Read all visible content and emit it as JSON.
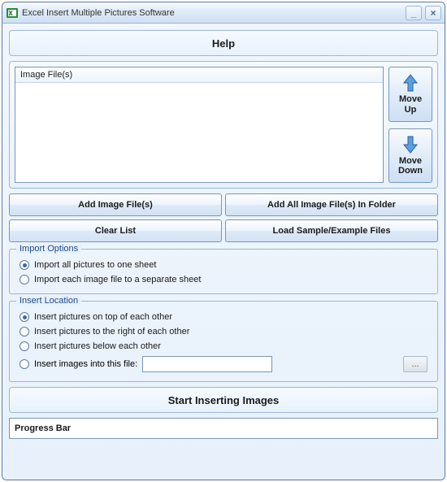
{
  "window": {
    "title": "Excel Insert Multiple Pictures Software"
  },
  "help": {
    "label": "Help"
  },
  "list": {
    "header": "Image File(s)"
  },
  "moveButtons": {
    "up": "Move\nUp",
    "down": "Move\nDown"
  },
  "buttons": {
    "addFiles": "Add Image File(s)",
    "addFolder": "Add All Image File(s) In Folder",
    "clear": "Clear List",
    "loadSample": "Load Sample/Example Files"
  },
  "importOptions": {
    "legend": "Import Options",
    "opt1": "Import all pictures to one sheet",
    "opt2": "Import each image file to a separate sheet"
  },
  "insertLocation": {
    "legend": "Insert Location",
    "opt1": "Insert pictures on top of each other",
    "opt2": "Insert pictures to the right of each other",
    "opt3": "Insert pictures below each other",
    "opt4": "Insert images into this file:",
    "browse": "..."
  },
  "start": {
    "label": "Start Inserting Images"
  },
  "progress": {
    "label": "Progress Bar"
  }
}
